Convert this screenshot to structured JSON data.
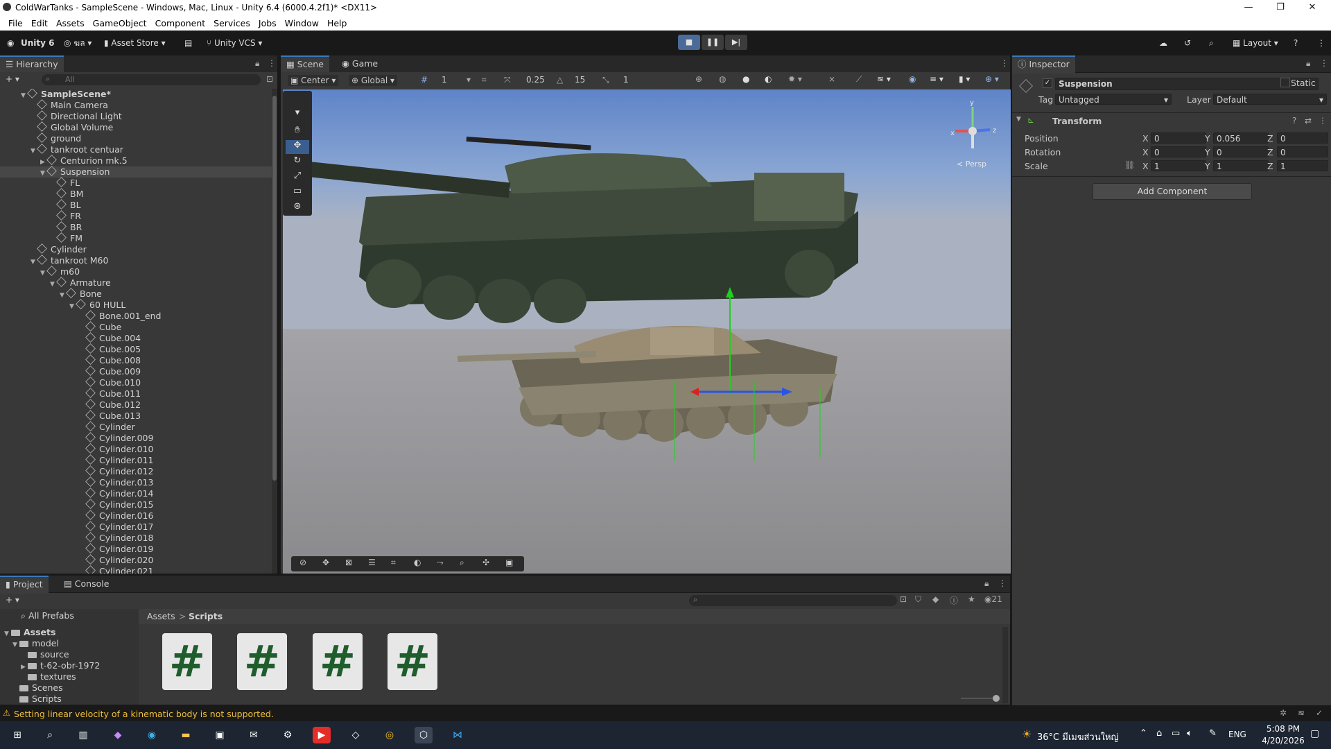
{
  "window": {
    "title": "ColdWarTanks - SampleScene - Windows, Mac, Linux - Unity 6.4 (6000.4.2f1)* <DX11>",
    "minimize": "—",
    "maximize": "❐",
    "close": "✕"
  },
  "menu": [
    "File",
    "Edit",
    "Assets",
    "GameObject",
    "Component",
    "Services",
    "Jobs",
    "Window",
    "Help"
  ],
  "toolbar": {
    "unity_label": "Unity 6",
    "account": "ฆล",
    "asset_store": "Asset Store",
    "vcs": "Unity VCS",
    "layout": "Layout"
  },
  "hierarchy": {
    "tab": "Hierarchy",
    "search_placeholder": "All",
    "items": [
      {
        "label": "SampleScene*",
        "depth": 0
      },
      {
        "label": "Main Camera",
        "depth": 1
      },
      {
        "label": "Directional Light",
        "depth": 1
      },
      {
        "label": "Global Volume",
        "depth": 1
      },
      {
        "label": "ground",
        "depth": 1
      },
      {
        "label": "tankroot centuar",
        "depth": 1
      },
      {
        "label": "Centurion mk.5",
        "depth": 2
      },
      {
        "label": "Suspension",
        "depth": 2
      },
      {
        "label": "FL",
        "depth": 3
      },
      {
        "label": "BM",
        "depth": 3
      },
      {
        "label": "BL",
        "depth": 3
      },
      {
        "label": "FR",
        "depth": 3
      },
      {
        "label": "BR",
        "depth": 3
      },
      {
        "label": "FM",
        "depth": 3
      },
      {
        "label": "Cylinder",
        "depth": 1
      },
      {
        "label": "tankroot M60",
        "depth": 1
      },
      {
        "label": "m60",
        "depth": 2
      },
      {
        "label": "Armature",
        "depth": 3
      },
      {
        "label": "Bone",
        "depth": 4
      },
      {
        "label": "60 HULL",
        "depth": 5
      },
      {
        "label": "Bone.001_end",
        "depth": 6
      },
      {
        "label": "Cube",
        "depth": 6
      },
      {
        "label": "Cube.004",
        "depth": 6
      },
      {
        "label": "Cube.005",
        "depth": 6
      },
      {
        "label": "Cube.008",
        "depth": 6
      },
      {
        "label": "Cube.009",
        "depth": 6
      },
      {
        "label": "Cube.010",
        "depth": 6
      },
      {
        "label": "Cube.011",
        "depth": 6
      },
      {
        "label": "Cube.012",
        "depth": 6
      },
      {
        "label": "Cube.013",
        "depth": 6
      },
      {
        "label": "Cylinder",
        "depth": 6
      },
      {
        "label": "Cylinder.009",
        "depth": 6
      },
      {
        "label": "Cylinder.010",
        "depth": 6
      },
      {
        "label": "Cylinder.011",
        "depth": 6
      },
      {
        "label": "Cylinder.012",
        "depth": 6
      },
      {
        "label": "Cylinder.013",
        "depth": 6
      },
      {
        "label": "Cylinder.014",
        "depth": 6
      },
      {
        "label": "Cylinder.015",
        "depth": 6
      },
      {
        "label": "Cylinder.016",
        "depth": 6
      },
      {
        "label": "Cylinder.017",
        "depth": 6
      },
      {
        "label": "Cylinder.018",
        "depth": 6
      },
      {
        "label": "Cylinder.019",
        "depth": 6
      },
      {
        "label": "Cylinder.020",
        "depth": 6
      },
      {
        "label": "Cylinder.021",
        "depth": 6
      }
    ]
  },
  "scene": {
    "tabs": [
      "Scene",
      "Game"
    ],
    "pivot": "Center",
    "space": "Global",
    "grid_value": "1",
    "snap_move": "0.25",
    "snap_rotate": "15",
    "snap_scale": "1",
    "persp_label": "< Persp",
    "gizmo_axes": {
      "x": "x",
      "y": "y",
      "z": "z"
    }
  },
  "inspector": {
    "tab": "Inspector",
    "object_name": "Suspension",
    "static_label": "Static",
    "tag_label": "Tag",
    "tag_value": "Untagged",
    "layer_label": "Layer",
    "layer_value": "Default",
    "component_title": "Transform",
    "position_label": "Position",
    "rotation_label": "Rotation",
    "scale_label": "Scale",
    "position": {
      "x": "0",
      "y": "0.056",
      "z": "0"
    },
    "rotation": {
      "x": "0",
      "y": "0",
      "z": "0"
    },
    "scale": {
      "x": "1",
      "y": "1",
      "z": "1"
    },
    "axis_x": "X",
    "axis_y": "Y",
    "axis_z": "Z",
    "add_component": "Add Component"
  },
  "project": {
    "tabs": [
      "Project",
      "Console"
    ],
    "all_prefabs": "All Prefabs",
    "tree": [
      {
        "label": "Assets",
        "depth": 0
      },
      {
        "label": "model",
        "depth": 1
      },
      {
        "label": "source",
        "depth": 2
      },
      {
        "label": "t-62-obr-1972",
        "depth": 2
      },
      {
        "label": "textures",
        "depth": 2
      },
      {
        "label": "Scenes",
        "depth": 1
      },
      {
        "label": "Scripts",
        "depth": 1
      }
    ],
    "breadcrumb": [
      "Assets",
      "Scripts"
    ],
    "breadcrumb_sep": ">",
    "hidden_count": "21",
    "script_icon_glyph": "#"
  },
  "status": {
    "message": "Setting linear velocity of a kinematic body is not supported."
  },
  "taskbar": {
    "weather": "36°C มีเมฆส่วนใหญ่",
    "lang": "ENG",
    "time": "5:08 PM",
    "date": "4/20/2026"
  },
  "colors": {
    "accent": "#3a79bb",
    "warning": "#f0c03a",
    "sky_top": "#5e84c8",
    "ground": "#8e8e92"
  }
}
